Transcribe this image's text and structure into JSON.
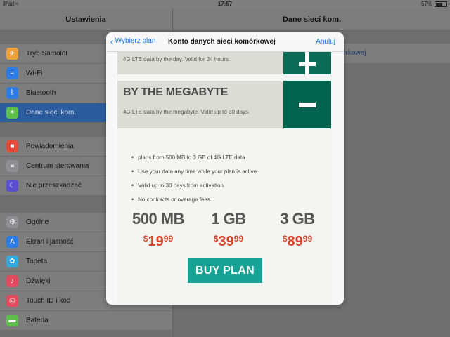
{
  "status_bar": {
    "carrier": "iPad",
    "time": "17:57",
    "battery": "57%",
    "battery_level": 0.57
  },
  "master": {
    "title": "Ustawienia",
    "groups": [
      [
        {
          "label": "Tryb Samolot",
          "icon": "airplane-icon",
          "color": "#f0a23a"
        },
        {
          "label": "Wi-Fi",
          "icon": "wifi-icon",
          "color": "#2d7ce6"
        },
        {
          "label": "Bluetooth",
          "icon": "bluetooth-icon",
          "color": "#2d7ce6"
        },
        {
          "label": "Dane sieci kom.",
          "icon": "antenna-icon",
          "color": "#5dbf4a",
          "selected": true
        }
      ],
      [
        {
          "label": "Powiadomienia",
          "icon": "notifications-icon",
          "color": "#e44a3c"
        },
        {
          "label": "Centrum sterowania",
          "icon": "control-center-icon",
          "color": "#8e8e93"
        },
        {
          "label": "Nie przeszkadzać",
          "icon": "moon-icon",
          "color": "#5b4ed1"
        }
      ],
      [
        {
          "label": "Ogólne",
          "icon": "gear-icon",
          "color": "#8e8e93"
        },
        {
          "label": "Ekran i jasność",
          "icon": "display-icon",
          "color": "#2d7ce6"
        },
        {
          "label": "Tapeta",
          "icon": "wallpaper-icon",
          "color": "#34aadc"
        },
        {
          "label": "Dźwięki",
          "icon": "sound-icon",
          "color": "#e44a5f"
        },
        {
          "label": "Touch ID i kod",
          "icon": "fingerprint-icon",
          "color": "#e44a5f"
        },
        {
          "label": "Bateria",
          "icon": "battery-icon",
          "color": "#5dbf4a"
        }
      ]
    ]
  },
  "detail": {
    "title": "Dane sieci kom.",
    "cell_text": "órkowej"
  },
  "modal": {
    "back_label": "Wybierz plan",
    "title": "Konto danych sieci komórkowej",
    "cancel_label": "Anuluj",
    "day_card": {
      "desc": "4G LTE data by the day. Valid for 24 hours."
    },
    "mb_card": {
      "name": "BY THE MEGABYTE",
      "desc": "4G LTE data by the megabyte. Valid up to 30 days."
    },
    "features": [
      "plans from 500 MB to 3 GB of 4G LTE data",
      "Use your data any time while your plan is active",
      "Valid up to 30 days from activation",
      "No contracts or overage fees"
    ],
    "plans": [
      {
        "size": "500 MB",
        "currency": "$",
        "price": "19",
        "cents": "99"
      },
      {
        "size": "1 GB",
        "currency": "$",
        "price": "39",
        "cents": "99"
      },
      {
        "size": "3 GB",
        "currency": "$",
        "price": "89",
        "cents": "99"
      }
    ],
    "buy_label": "BUY PLAN"
  }
}
